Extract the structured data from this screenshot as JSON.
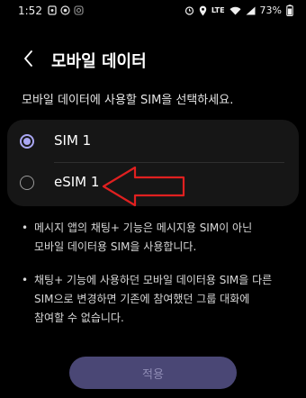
{
  "status_bar": {
    "time": "1:52",
    "network": "LTE",
    "battery": "73%"
  },
  "header": {
    "title": "모바일 데이터"
  },
  "instruction": "모바일 데이터에 사용할 SIM을 선택하세요.",
  "sim_options": [
    {
      "label": "SIM 1",
      "selected": true
    },
    {
      "label": "eSIM 1",
      "selected": false
    }
  ],
  "notes": [
    {
      "bullet": "•",
      "lines": [
        "메시지 앱의 채팅+ 기능은 메시지용 SIM이 아닌",
        "모바일 데이터용 SIM을 사용합니다."
      ]
    },
    {
      "bullet": "•",
      "lines": [
        "채팅+ 기능에 사용하던 모바일 데이터용 SIM을 다른",
        "SIM으로 변경하면 기존에 참여했던 그룹 대화에",
        "참여할 수 없습니다."
      ]
    }
  ],
  "apply_button": {
    "label": "적용"
  },
  "colors": {
    "accent": "#a9a6f2",
    "annotation_arrow": "#e02020",
    "card_bg": "#161616",
    "button_bg": "#4a4775"
  },
  "icons": [
    "notification-icon",
    "target-icon",
    "instagram-icon",
    "alarm-icon",
    "location-icon",
    "wifi-icon",
    "signal-icon",
    "battery-icon",
    "back-arrow-icon"
  ]
}
